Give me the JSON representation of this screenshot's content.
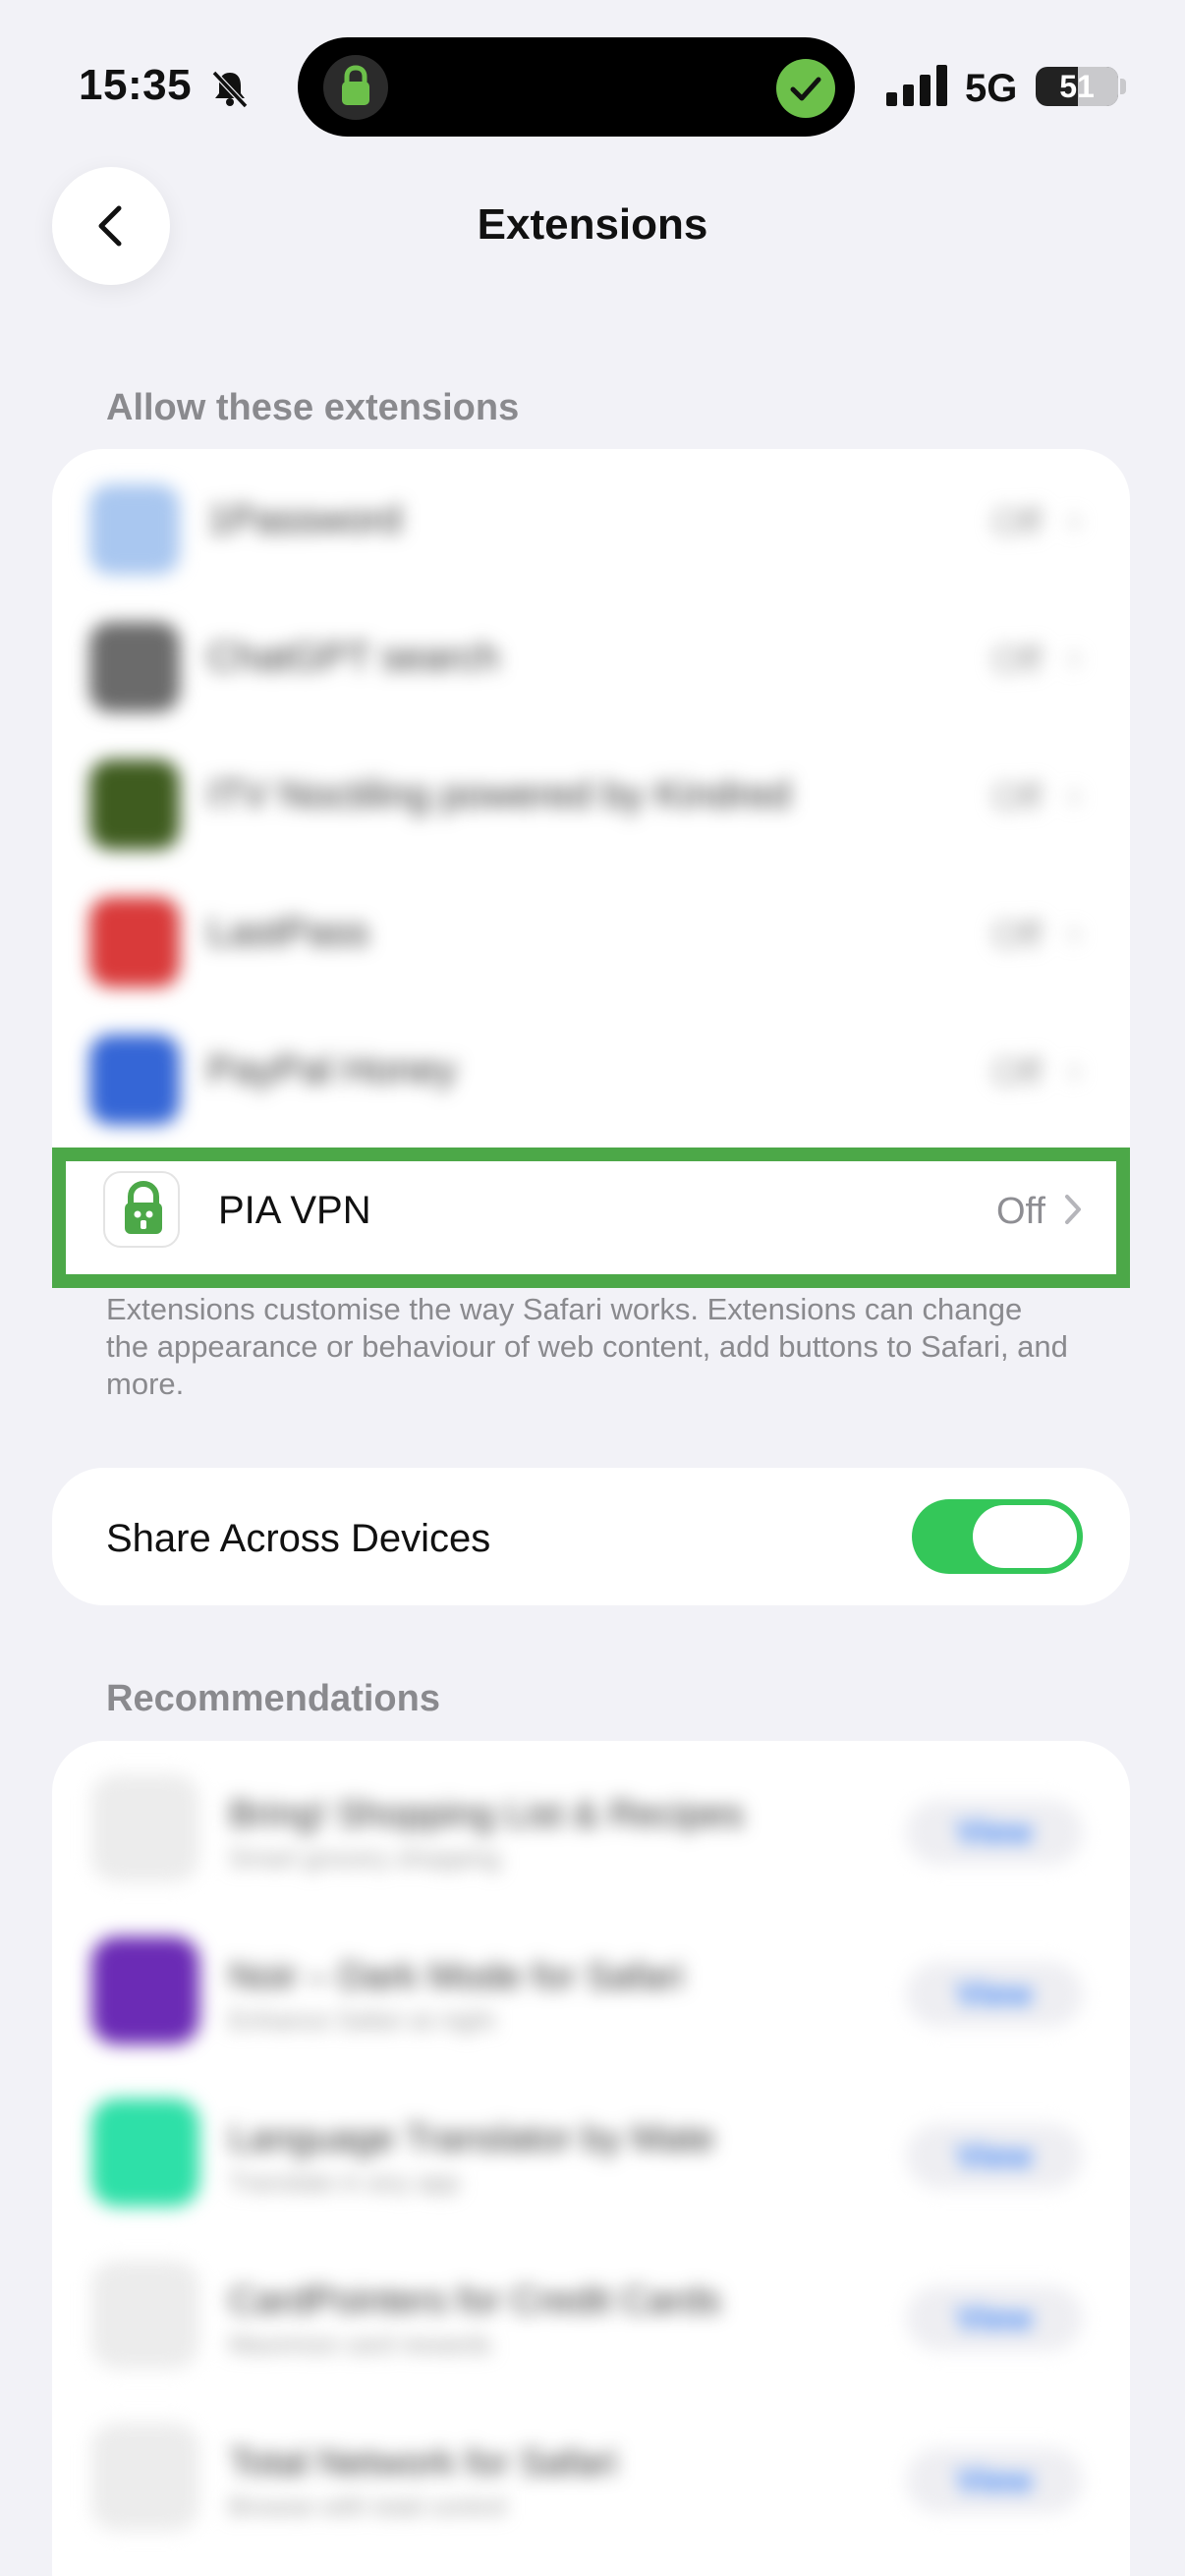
{
  "status_bar": {
    "time": "15:35",
    "network": "5G",
    "battery_level": "51",
    "battery_fraction": 0.51
  },
  "header": {
    "title": "Extensions"
  },
  "extensions": {
    "section_label": "Allow these extensions",
    "items": [
      {
        "label": "1Password",
        "value": "Off",
        "icon_color": "#a9c7f0"
      },
      {
        "label": "ChatGPT search",
        "value": "Off",
        "icon_color": "#6b6b6b"
      },
      {
        "label": "ITV Noctiling powered by Kindred",
        "value": "Off",
        "icon_color": "#3f5c1f"
      },
      {
        "label": "LastPass",
        "value": "Off",
        "icon_color": "#d93a3a"
      },
      {
        "label": "PayPal Honey",
        "value": "Off",
        "icon_color": "#3566d6"
      }
    ],
    "highlighted": {
      "label": "PIA VPN",
      "value": "Off",
      "icon": "pia-lock-icon",
      "highlight_color": "#4ca848"
    },
    "footnote": "Extensions customise the way Safari works. Extensions can change the appearance or behaviour of web content, add buttons to Safari, and more."
  },
  "share": {
    "label": "Share Across Devices",
    "enabled": true,
    "toggle_color": "#34c759"
  },
  "recommendations": {
    "section_label": "Recommendations",
    "items": [
      {
        "name": "Bring! Shopping List & Recipes",
        "sub": "Smart grocery shopping",
        "button": "View",
        "icon_color": "#ececec"
      },
      {
        "name": "Noir – Dark Mode for Safari",
        "sub": "Enhance Safari at night",
        "button": "View",
        "icon_color": "#6b2bb5"
      },
      {
        "name": "Language Translator by Mate",
        "sub": "Translate in any app",
        "button": "View",
        "icon_color": "#2ee0a8"
      },
      {
        "name": "CardPointers for Credit Cards",
        "sub": "Maximize card rewards",
        "button": "View",
        "icon_color": "#ececec"
      },
      {
        "name": "Total Network for Safari",
        "sub": "Browse with total control",
        "button": "View",
        "icon_color": "#ececec"
      }
    ]
  }
}
